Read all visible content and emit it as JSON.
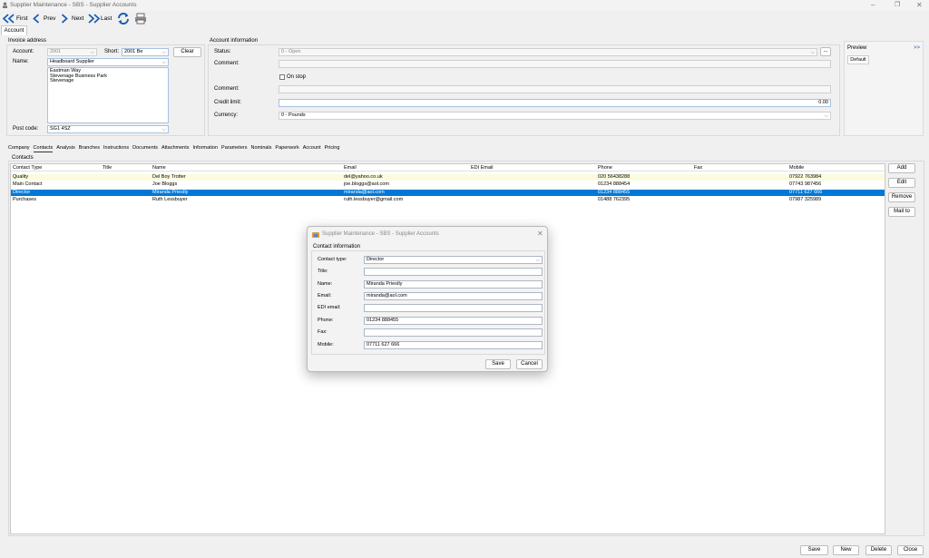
{
  "window": {
    "title": "Supplier Maintenance - SBS - Supplier Accounts"
  },
  "toolbar": {
    "first": "First",
    "prev": "Prev",
    "next": "Next",
    "last": "Last"
  },
  "main_tab": "Account",
  "invoice": {
    "section": "Invoice address",
    "account_label": "Account:",
    "account_value": "2001",
    "short_label": "Short:",
    "short_value": "2001 Be",
    "clear": "Clear",
    "name_label": "Name:",
    "name_value": "Headboard Supplier",
    "address": [
      "Eastman Way",
      "Stevenage Business Park",
      "Stevenage"
    ],
    "postcode_label": "Post code:",
    "postcode_value": "SG1 4SZ"
  },
  "account_info": {
    "section": "Account information",
    "status_label": "Status:",
    "status_value": "0 - Open",
    "comment_label": "Comment:",
    "comment2_label": "Comment:",
    "onstop_label": "On stop",
    "credit_label": "Credit limit:",
    "credit_value": "0.00",
    "currency_label": "Currency:",
    "currency_value": "0 - Pounds",
    "ellipsis": "..."
  },
  "preview": {
    "title": "Preview",
    "expand": ">>",
    "tab": "Default"
  },
  "subtabs": [
    "Company",
    "Contacts",
    "Analysis",
    "Branches",
    "Instructions",
    "Documents",
    "Attachments",
    "Information",
    "Parameters",
    "Nominals",
    "Paperwork",
    "Account",
    "Pricing"
  ],
  "contacts": {
    "section": "Contacts",
    "headers": [
      "Contact Type",
      "Title",
      "Name",
      "Email",
      "EDI Email",
      "Phone",
      "Fax",
      "Mobile"
    ],
    "rows": [
      {
        "type": "Quality",
        "title": "",
        "name": "Del Boy Trotter",
        "email": "del@yahoo.co.uk",
        "edi": "",
        "phone": "020 56438288",
        "fax": "",
        "mobile": "07922 763984"
      },
      {
        "type": "Main Contact",
        "title": "",
        "name": "Joe Bloggs",
        "email": "joe.bloggs@aol.com",
        "edi": "",
        "phone": "01234 888454",
        "fax": "",
        "mobile": "07743 987456"
      },
      {
        "type": "Director",
        "title": "",
        "name": "Miranda Priestly",
        "email": "miranda@aol.com",
        "edi": "",
        "phone": "01234 888455",
        "fax": "",
        "mobile": "07711 627 666"
      },
      {
        "type": "Purchases",
        "title": "",
        "name": "Ruth Lessbuyer",
        "email": "ruth.lessbuyer@gmail.com",
        "edi": "",
        "phone": "01488 762395",
        "fax": "",
        "mobile": "07987 325989"
      }
    ],
    "selected_row": 2,
    "buttons": {
      "add": "Add",
      "edit": "Edit",
      "remove": "Remove",
      "mailto": "Mail to"
    }
  },
  "dialog": {
    "title": "Supplier Maintenance - SBS - Supplier Accounts",
    "section": "Contact information",
    "fields": [
      {
        "label": "Contact type:",
        "value": "Director"
      },
      {
        "label": "Title:",
        "value": ""
      },
      {
        "label": "Name:",
        "value": "Miranda Priestly"
      },
      {
        "label": "Email:",
        "value": "miranda@aol.com"
      },
      {
        "label": "EDI email:",
        "value": ""
      },
      {
        "label": "Phone:",
        "value": "01234 888455"
      },
      {
        "label": "Fax:",
        "value": ""
      },
      {
        "label": "Mobile:",
        "value": "07711 627 666"
      }
    ],
    "save": "Save",
    "cancel": "Cancel"
  },
  "footer": {
    "save": "Save",
    "new": "New",
    "delete": "Delete",
    "close": "Close"
  },
  "colors": {
    "selection": "#0078d7",
    "alt_row": "#fbfbdf",
    "nav_icon": "#1a5fb4"
  }
}
